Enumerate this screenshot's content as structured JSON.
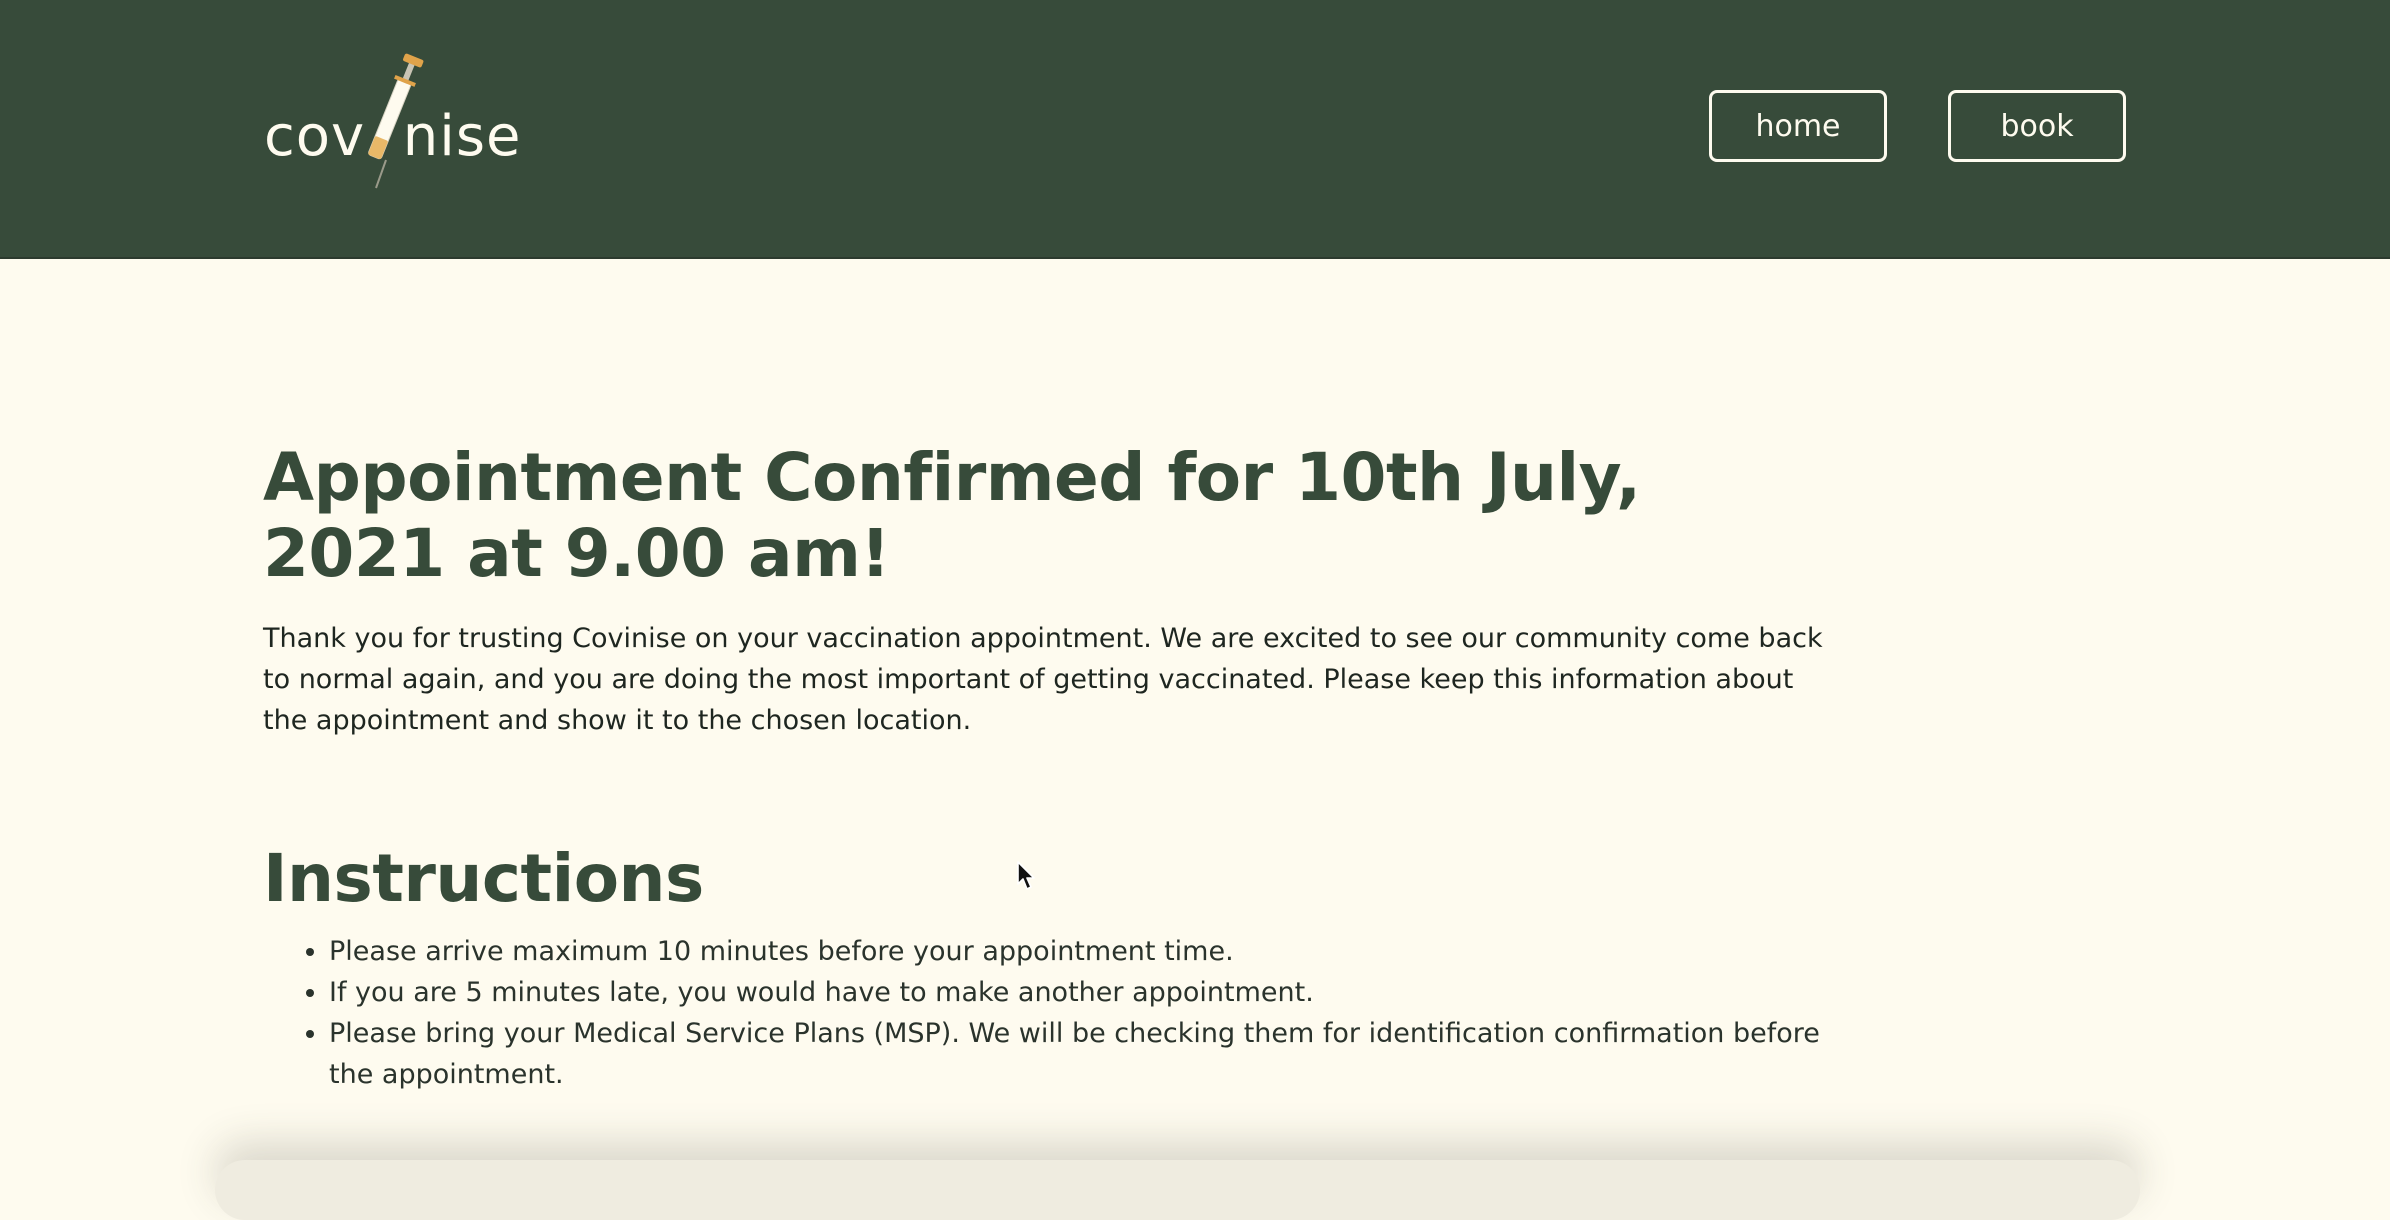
{
  "header": {
    "logo_text": "cov  nise",
    "nav": {
      "home_label": "home",
      "book_label": "book"
    }
  },
  "main": {
    "title": "Appointment Confirmed for 10th July, 2021 at 9.00 am!",
    "intro": "Thank you for trusting Covinise on your vaccination appointment. We are excited to see our community come back to normal again, and you are doing the most important of getting vaccinated. Please keep this information about the appointment and show it to the chosen location.",
    "instructions_title": "Instructions",
    "instructions": [
      "Please arrive maximum 10 minutes before your appointment time.",
      "If you are 5 minutes late, you would have to make another appointment.",
      "Please bring your Medical Service Plans (MSP). We will be checking them for identification confirmation before the appointment."
    ]
  },
  "colors": {
    "header_bg": "#374b3a",
    "page_bg": "#fefbef",
    "heading": "#374b3a",
    "syringe_accent": "#e0a34a"
  },
  "icons": {
    "logo_mark": "syringe-icon",
    "pointer": "mouse-cursor-icon"
  }
}
